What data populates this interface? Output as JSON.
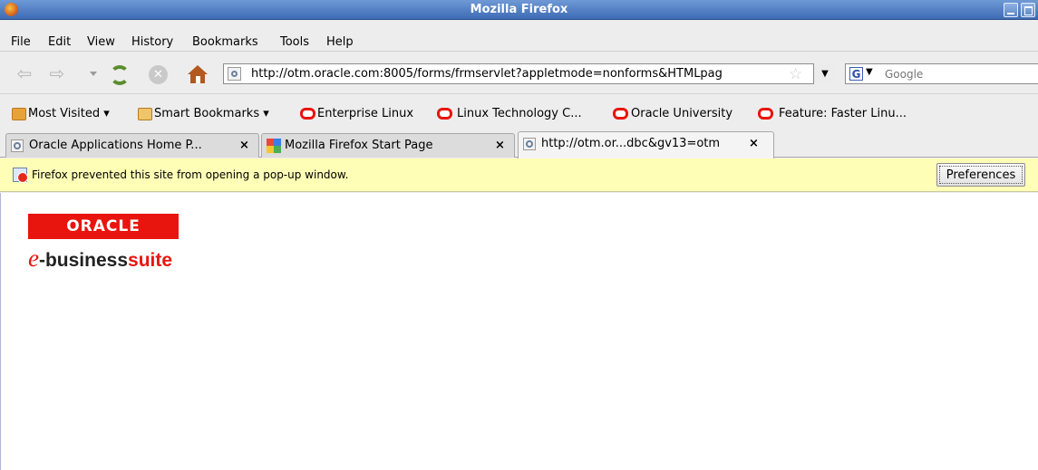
{
  "window": {
    "title": "Mozilla Firefox"
  },
  "menu": [
    "File",
    "Edit",
    "View",
    "History",
    "Bookmarks",
    "Tools",
    "Help"
  ],
  "navigation": {
    "url": "http://otm.oracle.com:8005/forms/frmservlet?appletmode=nonforms&HTMLpag",
    "search_placeholder": "Google"
  },
  "bookmarks": [
    "Most Visited",
    "Smart Bookmarks",
    "Enterprise Linux",
    "Linux Technology C...",
    "Oracle University",
    "Feature: Faster Linu..."
  ],
  "tabs": [
    {
      "label": "Oracle Applications Home P...",
      "active": false
    },
    {
      "label": "Mozilla Firefox Start Page",
      "active": false
    },
    {
      "label": "http://otm.or...dbc&gv13=otm",
      "active": true
    }
  ],
  "notification": {
    "message": "Firefox prevented this site from opening a pop-up window.",
    "button_label": "Preferences"
  },
  "page": {
    "logo_oracle": "ORACLE",
    "logo_e": "e",
    "logo_business": "-business",
    "logo_suite": "suite"
  },
  "colors": {
    "titlebar": "#3d6bb4",
    "notification_bg": "#fefeb7",
    "oracle_red": "#e8150e"
  }
}
